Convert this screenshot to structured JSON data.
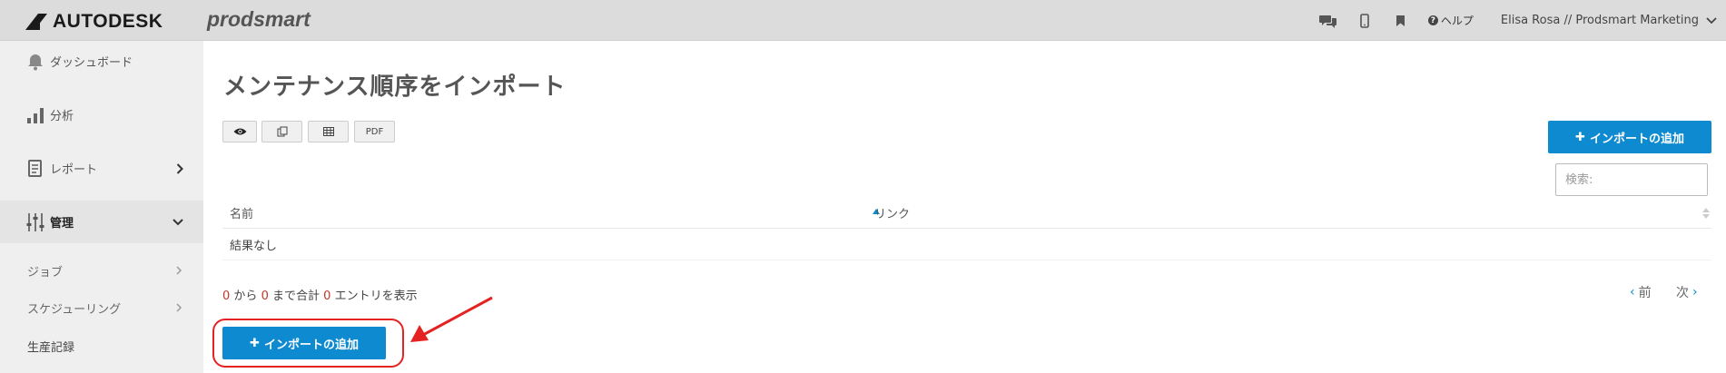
{
  "header": {
    "brand": "AUTODESK",
    "product": "prodsmart",
    "icons": [
      "chat-icon",
      "mobile-icon",
      "bookmark-icon"
    ],
    "help_label": "ヘルプ",
    "user_label": "Elisa Rosa // Prodsmart Marketing"
  },
  "sidebar": {
    "items": [
      {
        "label": "ダッシュボード",
        "icon": "bell-icon"
      },
      {
        "label": "分析",
        "icon": "bar-chart-icon"
      },
      {
        "label": "レポート",
        "icon": "report-icon"
      },
      {
        "label": "管理",
        "icon": "sliders-icon"
      }
    ],
    "subitems": [
      {
        "label": "ジョブ"
      },
      {
        "label": "スケジューリング"
      },
      {
        "label": "生産記録"
      }
    ]
  },
  "main": {
    "title": "メンテナンス順序をインポート",
    "toolbar": {
      "view_icon": "eye-icon",
      "copy_icon": "copy-icon",
      "table_icon": "table-icon",
      "pdf_label": "PDF"
    },
    "add_import_label": "インポートの追加",
    "search_placeholder": "検索:",
    "table": {
      "columns": [
        "名前",
        "リンク"
      ],
      "empty_text": "結果なし"
    },
    "info": {
      "from": "0",
      "from_suffix": "から",
      "to": "0",
      "to_suffix": "まで合計",
      "total": "0",
      "total_suffix": "エントリを表示"
    },
    "pager": {
      "prev": "前",
      "next": "次"
    }
  },
  "colors": {
    "accent": "#0e8ad0",
    "highlight": "#e52222",
    "topbar": "#dcdcdc",
    "sidebar": "#efefef"
  }
}
